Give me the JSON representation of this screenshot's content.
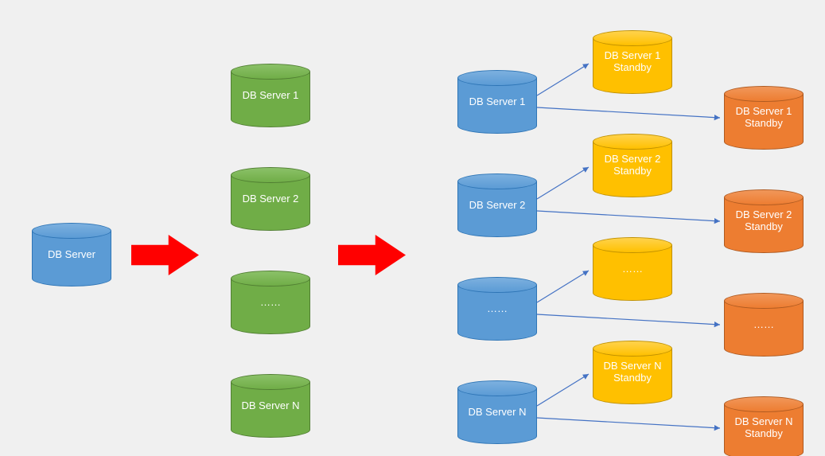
{
  "colors": {
    "blue": "#5b9bd5",
    "green": "#70ad47",
    "yellow": "#ffc000",
    "orange": "#ed7d31",
    "arrow_red": "#ff0000",
    "arrow_blue": "#4472c4"
  },
  "stage1": {
    "db": "DB Server"
  },
  "stage2": {
    "items": [
      {
        "label": "DB Server 1"
      },
      {
        "label": "DB Server 2"
      },
      {
        "label": "……"
      },
      {
        "label": "DB Server N"
      }
    ]
  },
  "stage3": {
    "groups": [
      {
        "primary": "DB Server 1",
        "standby_a": "DB Server 1\nStandby",
        "standby_b": "DB Server 1\nStandby"
      },
      {
        "primary": "DB Server 2",
        "standby_a": "DB Server 2\nStandby",
        "standby_b": "DB Server 2\nStandby"
      },
      {
        "primary": "……",
        "standby_a": "……",
        "standby_b": "……"
      },
      {
        "primary": "DB Server N",
        "standby_a": "DB Server N\nStandby",
        "standby_b": "DB Server N\nStandby"
      }
    ]
  }
}
